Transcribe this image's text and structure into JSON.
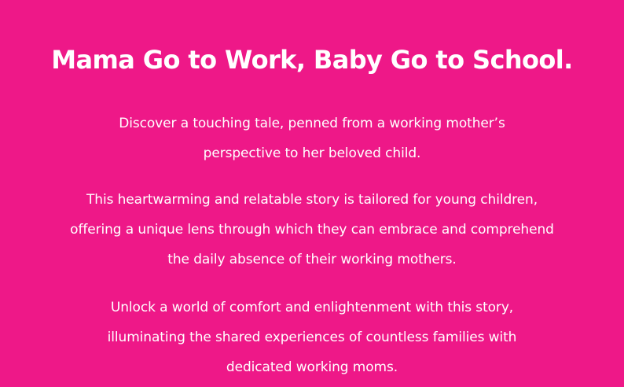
{
  "hero": {
    "title": "Mama Go to Work, Baby Go to School.",
    "paragraphs": [
      "Discover a touching tale, penned from a working mother’s perspective to her beloved child.",
      "This heartwarming and relatable story is tailored for young children, offering a unique lens through which they can embrace and comprehend the daily absence of their working mothers.",
      "Unlock a world of comfort and enlightenment with this story, illuminating the shared experiences of countless families with dedicated working moms."
    ]
  },
  "colors": {
    "background": "#ee1888",
    "text": "#ffffff"
  }
}
